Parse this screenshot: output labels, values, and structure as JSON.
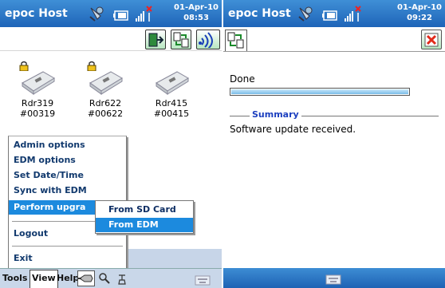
{
  "left": {
    "title": "epoc Host",
    "clock": {
      "date": "01-Apr-10",
      "time": "08:53"
    },
    "readers": [
      {
        "name": "Rdr319",
        "id": "#00319"
      },
      {
        "name": "Rdr622",
        "id": "#00622"
      },
      {
        "name": "Rdr415",
        "id": "#00415"
      }
    ],
    "menu": {
      "items": [
        {
          "label": "Admin options"
        },
        {
          "label": "EDM options"
        },
        {
          "label": "Set Date/Time"
        },
        {
          "label": "Sync with EDM"
        },
        {
          "label": "Perform upgra"
        },
        {
          "label": "Logout"
        },
        {
          "label": "Exit"
        }
      ],
      "selected": "Perform upgra",
      "submenu": [
        {
          "label": "From SD Card"
        },
        {
          "label": "From EDM"
        }
      ],
      "submenu_selected": "From EDM"
    },
    "menubar": {
      "tools": "Tools",
      "view": "View",
      "help": "Help"
    }
  },
  "right": {
    "title": "epoc Host",
    "clock": {
      "date": "01-Apr-10",
      "time": "09:22"
    },
    "status": "Done",
    "progress": 1.0,
    "summary_title": "Summary",
    "summary_text": "Software update received."
  },
  "colors": {
    "titlebar": "#1e64b8",
    "selection": "#1c8ade",
    "menubar": "#c9d7e9",
    "summary_title": "#1c3fbf"
  }
}
